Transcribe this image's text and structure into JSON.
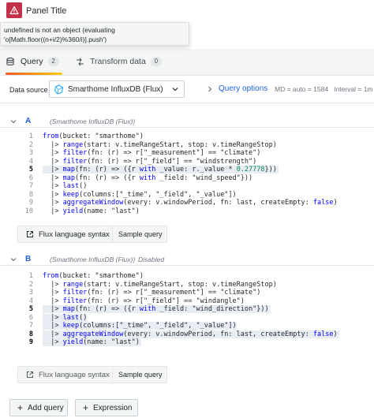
{
  "panel": {
    "title": "Panel Title",
    "error_tooltip": "undefined is not an object (evaluating 'o[Math.floor((n+i/2)%360/i)].push')"
  },
  "tabs": {
    "query": {
      "label": "Query",
      "count": "2"
    },
    "transform": {
      "label": "Transform data",
      "count": "0"
    }
  },
  "datasource": {
    "label": "Data source",
    "name": "Smarthome InfluxDB (Flux)",
    "query_options_label": "Query options",
    "query_options_info": "MD = auto = 1584   Interval = 1m"
  },
  "queries": [
    {
      "letter": "A",
      "datasource": "(Smarthome InfluxDB (Flux))",
      "disabled": "",
      "lines": [
        {
          "n": "1",
          "text": "from(bucket: \"smarthome\")"
        },
        {
          "n": "2",
          "text": "  |> range(start: v.timeRangeStart, stop: v.timeRangeStop)"
        },
        {
          "n": "3",
          "text": "  |> filter(fn: (r) => r[\"_measurement\"] == \"climate\")"
        },
        {
          "n": "4",
          "text": "  |> filter(fn: (r) => r[\"_field\"] == \"windstrength\")"
        },
        {
          "n": "5",
          "text": "  |> map(fn: (r) => ({r with _value: r._value * 0.27778}))"
        },
        {
          "n": "6",
          "text": "  |> map(fn: (r) => ({r with _field: \"wind_speed\"}))"
        },
        {
          "n": "7",
          "text": "  |> last()"
        },
        {
          "n": "8",
          "text": "  |> keep(columns:[\"_time\", \"_field\", \"_value\"])"
        },
        {
          "n": "9",
          "text": "  |> aggregateWindow(every: v.windowPeriod, fn: last, createEmpty: false)"
        },
        {
          "n": "10",
          "text": "  |> yield(name: \"last\")"
        }
      ],
      "syntax_button": "Flux language syntax",
      "sample_button": "Sample query"
    },
    {
      "letter": "B",
      "datasource": "(Smarthome InfluxDB (Flux))",
      "disabled": "Disabled",
      "lines": [
        {
          "n": "1",
          "text": "from(bucket: \"smarthome\")"
        },
        {
          "n": "2",
          "text": "  |> range(start: v.timeRangeStart, stop: v.timeRangeStop)"
        },
        {
          "n": "3",
          "text": "  |> filter(fn: (r) => r[\"_measurement\"] == \"climate\")"
        },
        {
          "n": "4",
          "text": "  |> filter(fn: (r) => r[\"_field\"] == \"windangle\")"
        },
        {
          "n": "5",
          "text": "  |> map(fn: (r) => ({r with _field: \"wind_direction\"}))"
        },
        {
          "n": "6",
          "text": "  |> last()"
        },
        {
          "n": "7",
          "text": "  |> keep(columns:[\"_time\", \"_field\", \"_value\"])"
        },
        {
          "n": "8",
          "text": "  |> aggregateWindow(every: v.windowPeriod, fn: last, createEmpty: false)"
        },
        {
          "n": "9",
          "text": "  |> yield(name: \"last\")"
        }
      ],
      "syntax_button": "Flux language syntax",
      "sample_button": "Sample query"
    }
  ],
  "actions": {
    "add_query": "Add query",
    "expression": "Expression"
  },
  "colors": {
    "accent_blue": "#1f62e0",
    "error_red": "#c4314b"
  }
}
